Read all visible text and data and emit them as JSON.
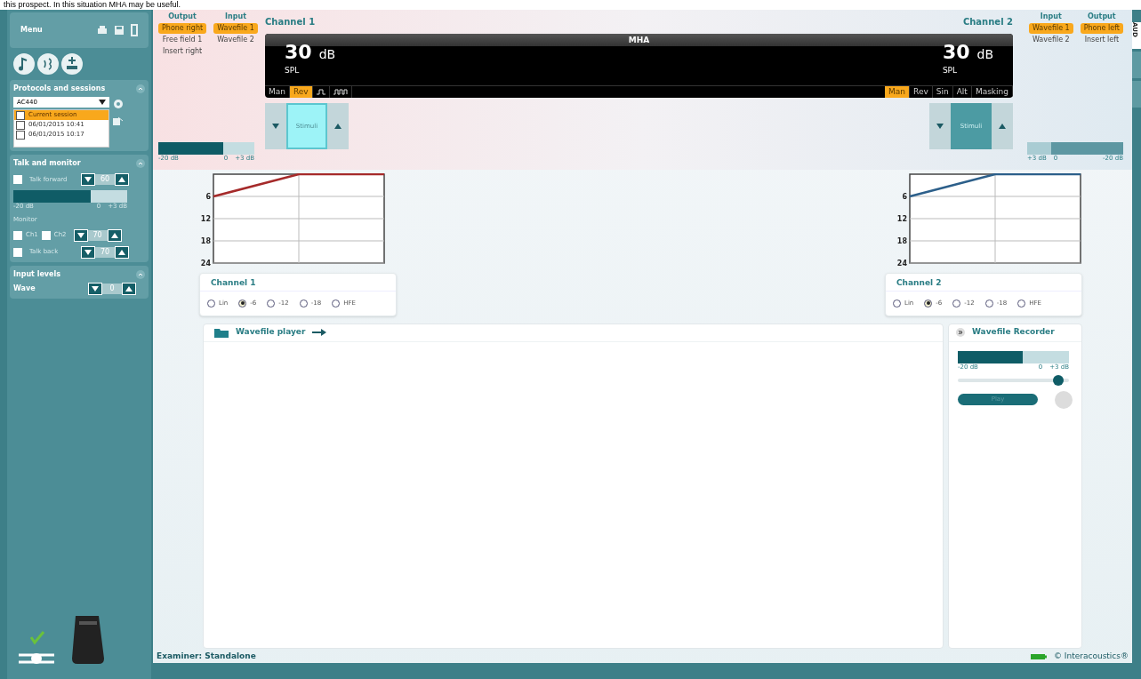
{
  "caption": "this prospect. In this situation MHA may be useful.",
  "sidebar": {
    "menu": "Menu",
    "protocols": {
      "title": "Protocols and sessions",
      "protocol": "AC440",
      "sessions": [
        {
          "label": "Current session",
          "checked": false,
          "selected": true
        },
        {
          "label": "06/01/2015 10:41",
          "checked": false,
          "selected": false
        },
        {
          "label": "06/01/2015 10:17",
          "checked": false,
          "selected": false
        }
      ]
    },
    "talk": {
      "title": "Talk and monitor",
      "talk_forward": {
        "label": "Talk forward",
        "checked": false,
        "value": "60"
      },
      "meter": {
        "level": 0.68,
        "min": "-20 dB",
        "zero": "0",
        "max": "+3 dB"
      },
      "monitor_label": "Monitor",
      "ch1": {
        "label": "Ch1",
        "checked": false
      },
      "ch2": {
        "label": "Ch2",
        "checked": false
      },
      "monitor_value": "70",
      "talk_back": {
        "label": "Talk back",
        "checked": false,
        "value": "70"
      }
    },
    "input_levels": {
      "title": "Input levels",
      "wave": {
        "label": "Wave",
        "value": "0"
      }
    }
  },
  "channels": [
    {
      "title": "Channel 1",
      "output_title": "Output",
      "outputs": [
        {
          "label": "Phone right",
          "selected": true
        },
        {
          "label": "Free field 1",
          "selected": false
        },
        {
          "label": "Insert right",
          "selected": false
        }
      ],
      "input_title": "Input",
      "inputs": [
        {
          "label": "Wavefile 1",
          "selected": true
        },
        {
          "label": "Wavefile 2",
          "selected": false
        }
      ],
      "level": "30",
      "unit": "dB",
      "scale": "SPL",
      "modes": [
        {
          "kind": "text",
          "label": "Man",
          "selected": false
        },
        {
          "kind": "text",
          "label": "Rev",
          "selected": true
        },
        {
          "kind": "single-pulse",
          "selected": false
        },
        {
          "kind": "pulse-train",
          "selected": false
        }
      ],
      "stimuli": {
        "label": "Stimuli",
        "selected": true
      },
      "meter": {
        "level": 0.68,
        "min": "-20 dB",
        "zero": "0",
        "max": "+3 dB"
      },
      "chart_data": {
        "type": "line",
        "grid": true,
        "series": [
          {
            "color": "#a52a2a",
            "values": [
              6,
              0,
              0
            ]
          }
        ],
        "ylim": [
          24,
          0
        ],
        "yticks": [
          6,
          12,
          18,
          24
        ]
      },
      "compression": {
        "title": "Channel 1",
        "options": [
          {
            "label": "Lin",
            "selected": false
          },
          {
            "label": "-6",
            "selected": true
          },
          {
            "label": "-12",
            "selected": false
          },
          {
            "label": "-18",
            "selected": false
          },
          {
            "label": "HFE",
            "selected": false
          }
        ]
      }
    },
    {
      "title": "Channel 2",
      "output_title": "Output",
      "outputs": [
        {
          "label": "Phone left",
          "selected": true
        },
        {
          "label": "Insert left",
          "selected": false
        }
      ],
      "input_title": "Input",
      "inputs": [
        {
          "label": "Wavefile 1",
          "selected": true
        },
        {
          "label": "Wavefile 2",
          "selected": false
        }
      ],
      "level": "30",
      "unit": "dB",
      "scale": "SPL",
      "modes": [
        {
          "kind": "text",
          "label": "Man",
          "selected": true
        },
        {
          "kind": "text",
          "label": "Rev",
          "selected": false
        },
        {
          "kind": "text",
          "label": "Sin",
          "selected": false
        },
        {
          "kind": "text",
          "label": "Alt",
          "selected": false
        },
        {
          "kind": "text",
          "label": "Masking",
          "selected": false
        }
      ],
      "stimuli": {
        "label": "Stimuli",
        "selected": false
      },
      "meter": {
        "level": 0.75,
        "min": "-20 dB",
        "zero": "0",
        "max": "+3 dB"
      },
      "chart_data": {
        "type": "line",
        "grid": true,
        "series": [
          {
            "color": "#2c5f8a",
            "values": [
              6,
              0,
              0
            ]
          }
        ],
        "ylim": [
          24,
          0
        ],
        "yticks": [
          6,
          12,
          18,
          24
        ]
      },
      "compression": {
        "title": "Channel 2",
        "options": [
          {
            "label": "Lin",
            "selected": false
          },
          {
            "label": "-6",
            "selected": true
          },
          {
            "label": "-12",
            "selected": false
          },
          {
            "label": "-18",
            "selected": false
          },
          {
            "label": "HFE",
            "selected": false
          }
        ]
      }
    }
  ],
  "display_label": "MHA",
  "player": {
    "title": "Wavefile player"
  },
  "recorder": {
    "title": "Wavefile Recorder",
    "meter": {
      "level": 0.58,
      "min": "-20 dB",
      "zero": "0",
      "max": "+3 dB"
    },
    "slider": {
      "level": 0.9
    },
    "play": "Play"
  },
  "side_tabs": [
    {
      "label": "AUD",
      "selected": true
    },
    {
      "selected": false
    },
    {
      "selected": false
    }
  ],
  "status": {
    "examiner": "Examiner: Standalone",
    "copyright": "© Interacoustics®"
  }
}
